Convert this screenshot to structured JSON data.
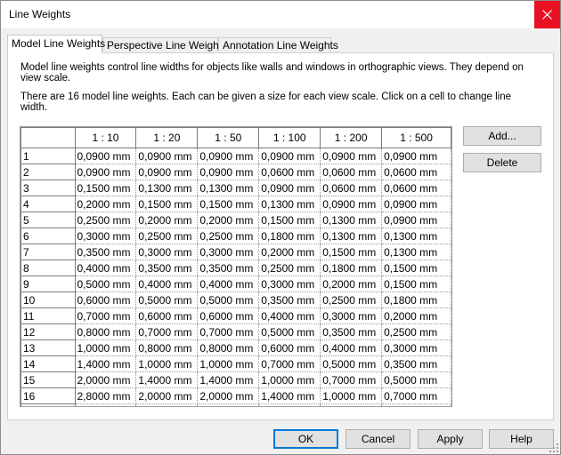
{
  "window": {
    "title": "Line Weights"
  },
  "tabs": [
    {
      "label": "Model Line Weights",
      "active": true
    },
    {
      "label": "Perspective Line Weights",
      "active": false
    },
    {
      "label": "Annotation Line Weights",
      "active": false
    }
  ],
  "description": {
    "line1": "Model line weights control line widths for objects like walls and windows in orthographic views. They depend on view scale.",
    "line2": "There are 16 model line weights. Each can be given a size for each view scale. Click on a cell to change line width."
  },
  "table": {
    "columns": [
      "1 : 10",
      "1 : 20",
      "1 : 50",
      "1 : 100",
      "1 : 200",
      "1 : 500"
    ],
    "rows": [
      {
        "id": "1",
        "values": [
          "0,0900 mm",
          "0,0900 mm",
          "0,0900 mm",
          "0,0900 mm",
          "0,0900 mm",
          "0,0900 mm"
        ]
      },
      {
        "id": "2",
        "values": [
          "0,0900 mm",
          "0,0900 mm",
          "0,0900 mm",
          "0,0600 mm",
          "0,0600 mm",
          "0,0600 mm"
        ]
      },
      {
        "id": "3",
        "values": [
          "0,1500 mm",
          "0,1300 mm",
          "0,1300 mm",
          "0,0900 mm",
          "0,0600 mm",
          "0,0600 mm"
        ]
      },
      {
        "id": "4",
        "values": [
          "0,2000 mm",
          "0,1500 mm",
          "0,1500 mm",
          "0,1300 mm",
          "0,0900 mm",
          "0,0900 mm"
        ]
      },
      {
        "id": "5",
        "values": [
          "0,2500 mm",
          "0,2000 mm",
          "0,2000 mm",
          "0,1500 mm",
          "0,1300 mm",
          "0,0900 mm"
        ]
      },
      {
        "id": "6",
        "values": [
          "0,3000 mm",
          "0,2500 mm",
          "0,2500 mm",
          "0,1800 mm",
          "0,1300 mm",
          "0,1300 mm"
        ]
      },
      {
        "id": "7",
        "values": [
          "0,3500 mm",
          "0,3000 mm",
          "0,3000 mm",
          "0,2000 mm",
          "0,1500 mm",
          "0,1300 mm"
        ]
      },
      {
        "id": "8",
        "values": [
          "0,4000 mm",
          "0,3500 mm",
          "0,3500 mm",
          "0,2500 mm",
          "0,1800 mm",
          "0,1500 mm"
        ]
      },
      {
        "id": "9",
        "values": [
          "0,5000 mm",
          "0,4000 mm",
          "0,4000 mm",
          "0,3000 mm",
          "0,2000 mm",
          "0,1500 mm"
        ]
      },
      {
        "id": "10",
        "values": [
          "0,6000 mm",
          "0,5000 mm",
          "0,5000 mm",
          "0,3500 mm",
          "0,2500 mm",
          "0,1800 mm"
        ]
      },
      {
        "id": "11",
        "values": [
          "0,7000 mm",
          "0,6000 mm",
          "0,6000 mm",
          "0,4000 mm",
          "0,3000 mm",
          "0,2000 mm"
        ]
      },
      {
        "id": "12",
        "values": [
          "0,8000 mm",
          "0,7000 mm",
          "0,7000 mm",
          "0,5000 mm",
          "0,3500 mm",
          "0,2500 mm"
        ]
      },
      {
        "id": "13",
        "values": [
          "1,0000 mm",
          "0,8000 mm",
          "0,8000 mm",
          "0,6000 mm",
          "0,4000 mm",
          "0,3000 mm"
        ]
      },
      {
        "id": "14",
        "values": [
          "1,4000 mm",
          "1,0000 mm",
          "1,0000 mm",
          "0,7000 mm",
          "0,5000 mm",
          "0,3500 mm"
        ]
      },
      {
        "id": "15",
        "values": [
          "2,0000 mm",
          "1,4000 mm",
          "1,4000 mm",
          "1,0000 mm",
          "0,7000 mm",
          "0,5000 mm"
        ]
      },
      {
        "id": "16",
        "values": [
          "2,8000 mm",
          "2,0000 mm",
          "2,0000 mm",
          "1,4000 mm",
          "1,0000 mm",
          "0,7000 mm"
        ]
      }
    ]
  },
  "side_buttons": {
    "add": "Add...",
    "delete": "Delete"
  },
  "footer": {
    "ok": "OK",
    "cancel": "Cancel",
    "apply": "Apply",
    "help": "Help"
  },
  "icons": {
    "close": "close-icon",
    "resize_grip": "resize-grip-icon"
  },
  "colors": {
    "close_bg": "#e81123",
    "primary_border": "#0078d7"
  }
}
